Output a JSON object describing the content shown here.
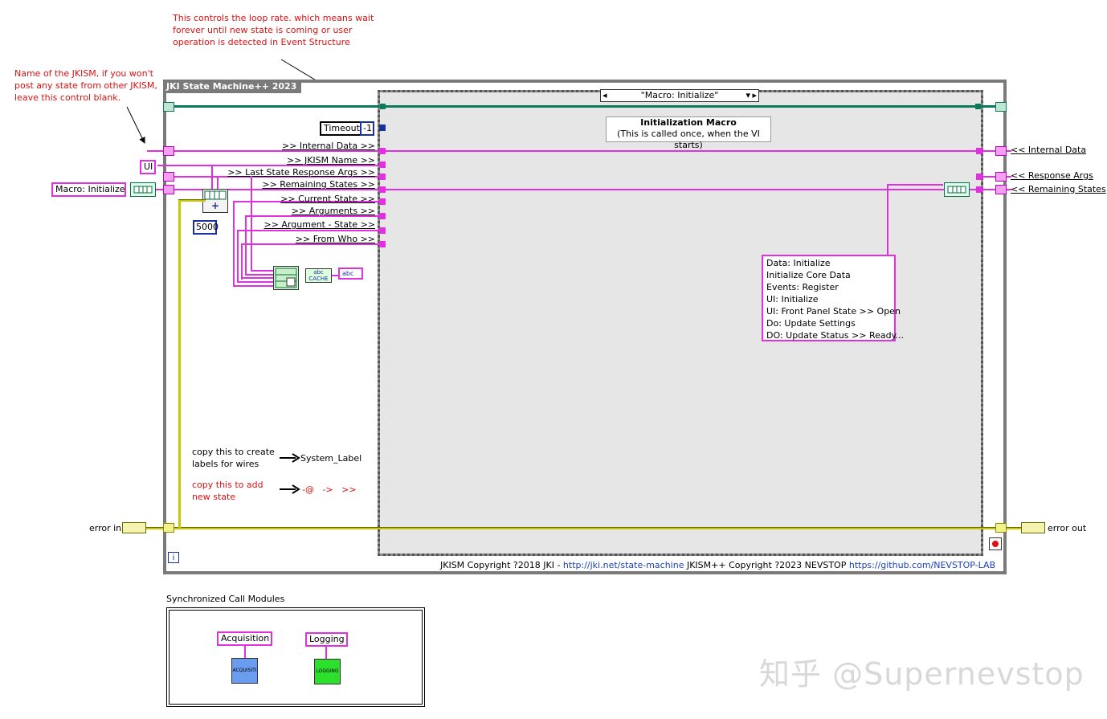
{
  "annotations": {
    "loop_rate_note": [
      "This controls the loop rate. which means wait",
      "forever until new state is coming or user",
      "operation is detected in Event Structure"
    ],
    "jkism_name_note": [
      "Name of the JKISM, if you won't",
      "post any state from other JKISM,",
      "leave this control blank."
    ]
  },
  "loop": {
    "label": "JKI State Machine++ 2023",
    "iteration_terminal": "i"
  },
  "case_selector": {
    "value": "\"Macro: Initialize\"",
    "left_arrow": "◂",
    "right_arrow": "▸",
    "dropdown": "▾"
  },
  "case_comment": {
    "title": "Initialization Macro",
    "subtitle": "(This is called once, when the VI starts)"
  },
  "timeout": {
    "label": "Timeout",
    "value": "-1"
  },
  "inputs": {
    "ui_name": "UI",
    "macro_init": "Macro: Initialize",
    "timeout_5000": "5000"
  },
  "wire_labels": [
    ">> Internal Data >>",
    ">> JKISM Name >>",
    ">> Last State Response Args >>",
    ">> Remaining States >>",
    ">> Current State >>",
    ">> Arguments >>",
    ">> Argument - State >>",
    ">> From Who >>"
  ],
  "output_labels": {
    "internal_data": "<< Internal Data",
    "response_args": "<< Response Args",
    "remaining_states": "<< Remaining States"
  },
  "states_list": [
    "Data: Initialize",
    "Initialize Core Data",
    "Events: Register",
    "UI: Initialize",
    "UI: Front Panel State >> Open",
    "Do: Update Settings",
    "DO: Update Status >> Ready..."
  ],
  "helpers": {
    "labels_note": [
      "copy this to create",
      "labels for wires"
    ],
    "system_label": "System_Label",
    "state_note": [
      "copy this to add",
      "new state"
    ],
    "state_tokens": "-@   ->   >>"
  },
  "error": {
    "in": "error in",
    "out": "error out"
  },
  "copyright": {
    "part1": "JKISM Copyright ?2018 JKI - ",
    "link1": "http://jki.net/state-machine",
    "part2": " JKISM++ Copyright ?2023 NEVSTOP ",
    "link2": "https://github.com/NEVSTOP-LAB"
  },
  "modules": {
    "title": "Synchronized Call Modules",
    "items": [
      {
        "label": "Acquisition",
        "icon_text": "ACQUISITI",
        "color": "#6a9cf0"
      },
      {
        "label": "Logging",
        "icon_text": "LOGGING",
        "color": "#2ee02e"
      }
    ]
  },
  "cache_node": "CACHE",
  "abc": "abc",
  "watermark": "知乎 @Supernevstop",
  "colors": {
    "pink_wire": "#e030e0",
    "error_wire": "#c8c800",
    "loop_border": "#7a7a7a",
    "case_bg": "#e6e6e6"
  }
}
